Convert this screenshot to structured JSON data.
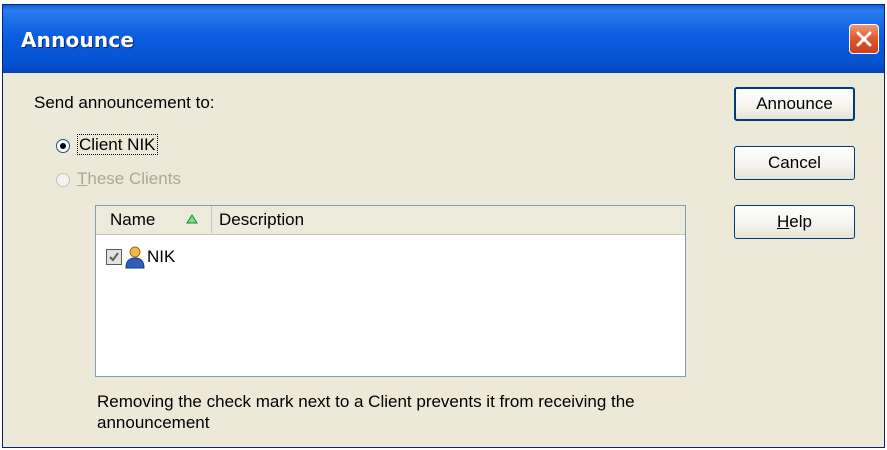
{
  "window": {
    "title": "Announce"
  },
  "send": {
    "label": "Send announcement to:",
    "options": [
      {
        "label": "Client NIK",
        "selected": true,
        "enabled": true
      },
      {
        "label": "These Clients",
        "selected": false,
        "enabled": false
      }
    ]
  },
  "clients_table": {
    "columns": [
      {
        "label": "Name",
        "sort": "ascending",
        "sort_icon": "sort-ascending-icon"
      },
      {
        "label": "Description"
      }
    ],
    "rows": [
      {
        "name": "NIK",
        "description": "",
        "checked": true,
        "icon": "user-icon"
      }
    ]
  },
  "note": "Removing the check mark next to a Client prevents it from receiving the announcement",
  "buttons": {
    "announce": "Announce",
    "cancel": "Cancel",
    "help": "Help"
  },
  "colors": {
    "titlebar": "#0553d2",
    "dialog_bg": "#ece9d8",
    "close_button": "#e05a32",
    "sort_arrow": "#1fa83a"
  }
}
